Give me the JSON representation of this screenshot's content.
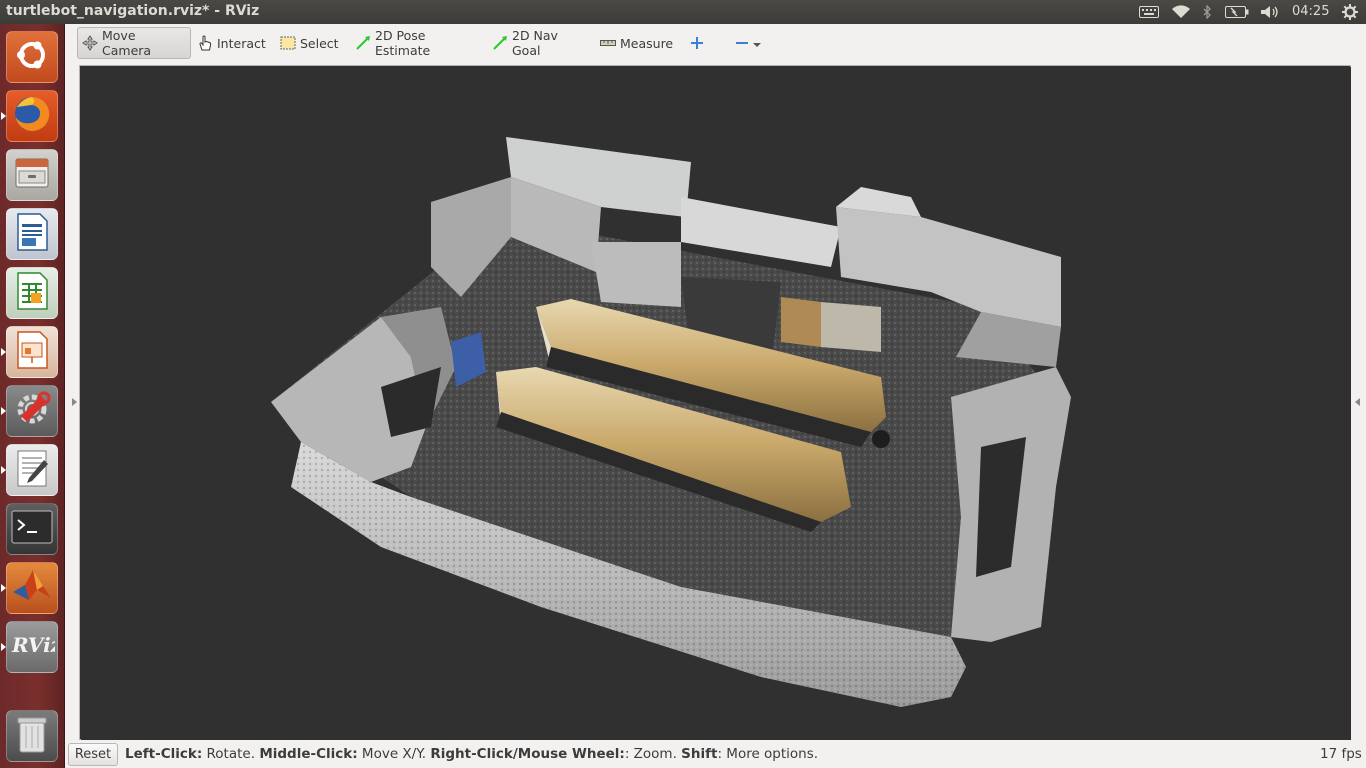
{
  "window": {
    "title": "turtlebot_navigation.rviz* - RViz"
  },
  "top_panel": {
    "clock": "04:25",
    "tray_icons": [
      "keyboard-icon",
      "wifi-icon",
      "bluetooth-icon",
      "battery-icon",
      "volume-icon",
      "gear-icon"
    ]
  },
  "launcher": {
    "items": [
      {
        "name": "ubuntu-dash",
        "icon": "ubuntu-logo-icon"
      },
      {
        "name": "firefox",
        "icon": "firefox-icon",
        "running": true
      },
      {
        "name": "files",
        "icon": "file-cabinet-icon"
      },
      {
        "name": "libreoffice-writer",
        "icon": "writer-icon"
      },
      {
        "name": "libreoffice-calc",
        "icon": "calc-icon"
      },
      {
        "name": "libreoffice-impress",
        "icon": "impress-icon",
        "running": true
      },
      {
        "name": "system-settings",
        "icon": "settings-wrench-icon",
        "running": true
      },
      {
        "name": "text-editor",
        "icon": "text-editor-icon",
        "running": true
      },
      {
        "name": "terminal",
        "icon": "terminal-icon",
        "label": ">_"
      },
      {
        "name": "matlab",
        "icon": "matlab-icon",
        "running": true
      },
      {
        "name": "rviz",
        "icon": "rviz-icon",
        "label": "RViz",
        "running": true
      },
      {
        "name": "trash",
        "icon": "trash-icon"
      }
    ]
  },
  "toolbar": {
    "move_camera": "Move Camera",
    "interact": "Interact",
    "select": "Select",
    "pose_estimate": "2D Pose Estimate",
    "nav_goal": "2D Nav Goal",
    "measure": "Measure"
  },
  "viewport": {
    "content": "3D point cloud render of office room",
    "background": "#303030"
  },
  "status": {
    "reset": "Reset",
    "k1": "Left-Click:",
    "v1": " Rotate. ",
    "k2": "Middle-Click:",
    "v2": " Move X/Y. ",
    "k3": "Right-Click/Mouse Wheel:",
    "v3": ": Zoom. ",
    "k4": "Shift",
    "v4": ": More options.",
    "fps": "17 fps"
  },
  "colors": {
    "launcher_bg": "#7a2f2c",
    "panel_bg": "#3c3b37",
    "viewport_bg": "#303030",
    "accent_green": "#2ec82e"
  }
}
